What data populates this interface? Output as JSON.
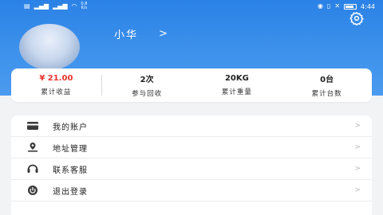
{
  "status_bar": {
    "speed_top": "0.8",
    "speed_bottom": "K/s",
    "time": "4:44"
  },
  "profile": {
    "username": "小华",
    "chevron": ">"
  },
  "stats": [
    {
      "value": "¥ 21.00",
      "label": "累计收益"
    },
    {
      "value": "2次",
      "label": "参与回收"
    },
    {
      "value": "20KG",
      "label": "累计重量"
    },
    {
      "value": "0台",
      "label": "累计台数"
    }
  ],
  "menu": [
    {
      "label": "我的账户",
      "icon": "card-icon"
    },
    {
      "label": "地址管理",
      "icon": "location-icon"
    },
    {
      "label": "联系客服",
      "icon": "headset-icon"
    },
    {
      "label": "退出登录",
      "icon": "power-icon"
    }
  ],
  "menu_chevron": ">",
  "colors": {
    "header": "#2b82e6",
    "money": "#e8352d"
  }
}
